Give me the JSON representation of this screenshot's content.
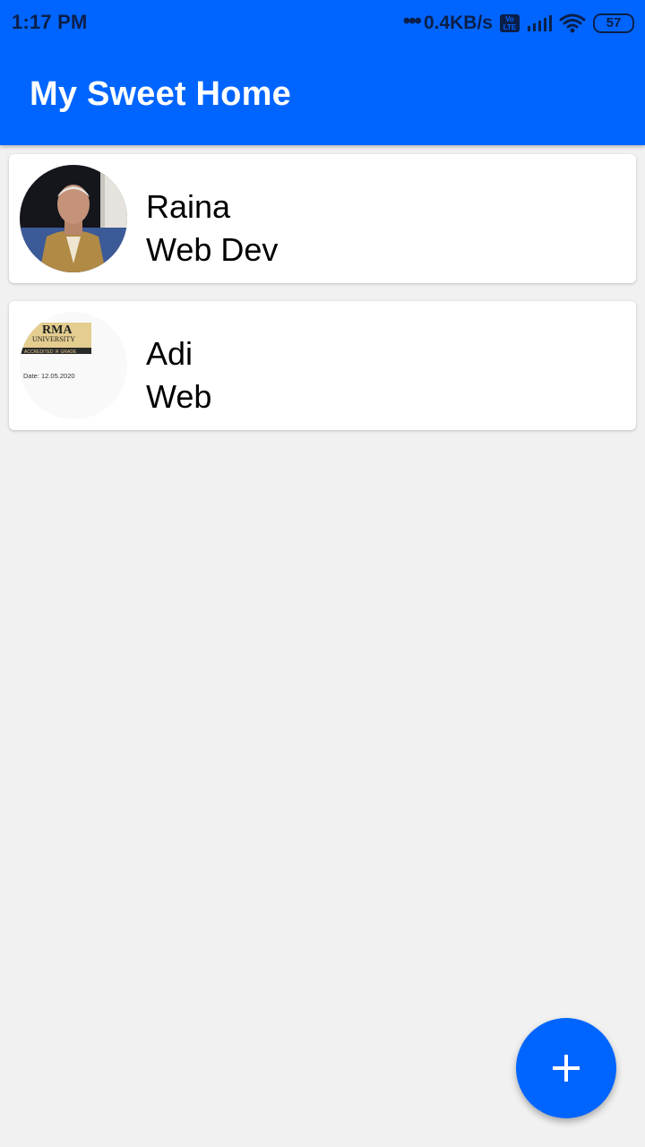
{
  "status_bar": {
    "time": "1:17 PM",
    "dots": "•••",
    "network_speed": "0.4KB/s",
    "volte_label_top": "Vo",
    "volte_label_bottom": "LTE",
    "battery_level": "57",
    "icons": [
      "volte-icon",
      "signal-icon",
      "wifi-icon",
      "battery-icon"
    ]
  },
  "app_bar": {
    "title": "My Sweet Home"
  },
  "contacts": [
    {
      "name": "Raina",
      "role": "Web Dev",
      "avatar": "person-photo"
    },
    {
      "name": "Adi",
      "role": "Web",
      "avatar": "document-photo",
      "avatar_text": {
        "line1": "RMA",
        "line2": "UNIVERSITY",
        "line3": "ACCREDITED 'A' GRADE",
        "line4": "Date: 12.05.2020"
      }
    }
  ],
  "fab": {
    "icon": "plus-icon"
  },
  "colors": {
    "primary": "#0065fe",
    "background": "#f1f1f1",
    "card": "#ffffff",
    "status_text": "#0b1f4a"
  }
}
